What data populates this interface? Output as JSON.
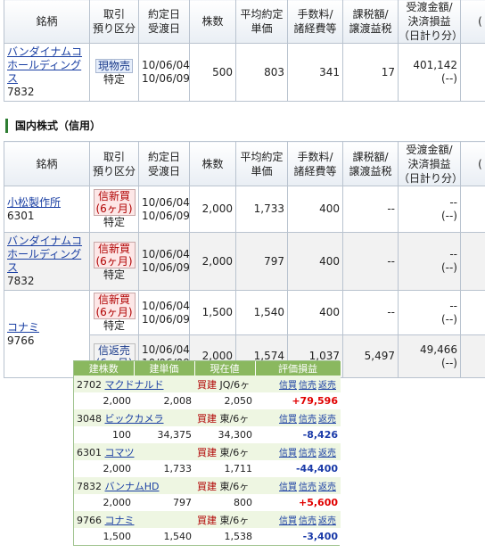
{
  "header_cols": {
    "name": "銘柄",
    "kind_1": "取引",
    "kind_2": "預り区分",
    "date_1": "約定日",
    "date_2": "受渡日",
    "qty": "株数",
    "price_1": "平均約定",
    "price_2": "単価",
    "fee_1": "手数料/",
    "fee_2": "諸経費等",
    "tax_1": "課税額/",
    "tax_2": "譲渡益税",
    "total_1": "受渡金額/",
    "total_2": "決済損益",
    "total_3": "（日計り分）",
    "extra": "("
  },
  "cash_row": {
    "name_line1": "バンダイナムコ",
    "name_line2": "ホールディングス",
    "code": "7832",
    "type": "現物売",
    "account": "特定",
    "trade_date": "10/06/04",
    "settle_date": "10/06/09",
    "qty": "500",
    "price": "803",
    "fee": "341",
    "tax": "17",
    "amount": "401,142",
    "day_pl": "(--)"
  },
  "section_title": "国内株式（信用）",
  "margin_rows": [
    {
      "name_line1": "小松製作所",
      "name_line2": "",
      "code": "6301",
      "type": "信新買",
      "term": "(6ヶ月)",
      "account": "特定",
      "trade_date": "10/06/04",
      "settle_date": "10/06/09",
      "qty": "2,000",
      "price": "1,733",
      "fee": "400",
      "tax": "--",
      "amount": "--",
      "day_pl": "(--)"
    },
    {
      "name_line1": "バンダイナムコ",
      "name_line2": "ホールディングス",
      "code": "7832",
      "type": "信新買",
      "term": "(6ヶ月)",
      "account": "特定",
      "trade_date": "10/06/04",
      "settle_date": "10/06/09",
      "qty": "2,000",
      "price": "797",
      "fee": "400",
      "tax": "--",
      "amount": "--",
      "day_pl": "(--)"
    },
    {
      "name_line1": "コナミ",
      "name_line2": "",
      "code": "9766",
      "type": "信新買",
      "term": "(6ヶ月)",
      "account": "特定",
      "trade_date": "10/06/04",
      "settle_date": "10/06/09",
      "qty": "1,500",
      "price": "1,540",
      "fee": "400",
      "tax": "--",
      "amount": "--",
      "day_pl": "(--)"
    },
    {
      "name_line1": "",
      "name_line2": "",
      "code": "",
      "type": "信返売",
      "term": "(6ヶ月)",
      "account": "",
      "trade_date": "10/06/04",
      "settle_date": "10/06/09",
      "qty": "2,000",
      "price": "1,574",
      "fee": "1,037",
      "tax": "5,497",
      "amount": "49,466",
      "day_pl": "(--)"
    }
  ],
  "popup": {
    "headers": [
      "建株数",
      "建単価",
      "現在値",
      "評価損益"
    ],
    "ops": [
      "信買",
      "信売",
      "返売"
    ],
    "positions": [
      {
        "code": "2702",
        "name": "マクドナルド",
        "action": "買建",
        "market": "JQ/6ヶ",
        "qty": "2,000",
        "cost": "2,008",
        "current": "2,050",
        "pl": "+79,596",
        "sign": "pos"
      },
      {
        "code": "3048",
        "name": "ビックカメラ",
        "action": "買建",
        "market": "東/6ヶ",
        "qty": "100",
        "cost": "34,375",
        "current": "34,300",
        "pl": "-8,426",
        "sign": "neg"
      },
      {
        "code": "6301",
        "name": "コマツ",
        "action": "買建",
        "market": "東/6ヶ",
        "qty": "2,000",
        "cost": "1,733",
        "current": "1,711",
        "pl": "-44,400",
        "sign": "neg"
      },
      {
        "code": "7832",
        "name": "バンナムHD",
        "action": "買建",
        "market": "東/6ヶ",
        "qty": "2,000",
        "cost": "797",
        "current": "800",
        "pl": "+5,600",
        "sign": "pos"
      },
      {
        "code": "9766",
        "name": "コナミ",
        "action": "買建",
        "market": "東/6ヶ",
        "qty": "1,500",
        "cost": "1,540",
        "current": "1,538",
        "pl": "-3,400",
        "sign": "neg"
      }
    ]
  },
  "colors": {
    "accent_green": "#8ab85f",
    "positive": "#e00000",
    "negative": "#1a3aa8",
    "link": "#1a3fa3"
  }
}
